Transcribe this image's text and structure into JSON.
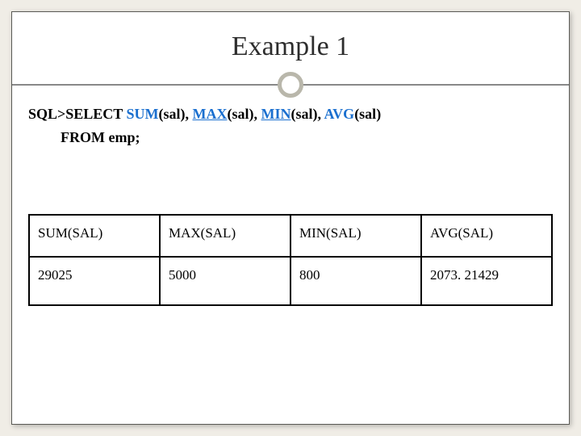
{
  "title": "Example 1",
  "sql": {
    "prefix": "SQL>SELECT ",
    "sum": "SUM",
    "max": "MAX",
    "min": "MIN",
    "avg": "AVG",
    "arg_sum": "(sal), ",
    "arg_max": "(sal), ",
    "arg_min": "(sal), ",
    "arg_avg": "(sal)",
    "line2": "FROM  emp;"
  },
  "table": {
    "headers": [
      "SUM(SAL)",
      "MAX(SAL)",
      "MIN(SAL)",
      "AVG(SAL)"
    ],
    "row": [
      "29025",
      "5000",
      "800",
      "2073. 21429"
    ]
  }
}
